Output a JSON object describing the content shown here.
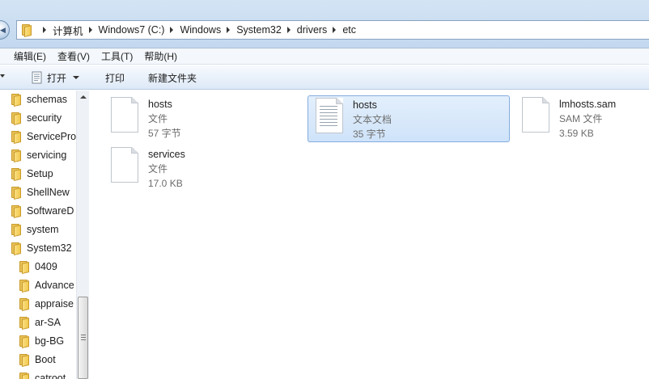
{
  "address": {
    "crumbs": [
      "计算机",
      "Windows7 (C:)",
      "Windows",
      "System32",
      "drivers",
      "etc"
    ]
  },
  "menu": [
    "编辑(E)",
    "查看(V)",
    "工具(T)",
    "帮助(H)"
  ],
  "toolbar": {
    "open_label": "打开",
    "print_label": "打印",
    "new_folder_label": "新建文件夹"
  },
  "sidebar": {
    "items": [
      {
        "label": "schemas"
      },
      {
        "label": "security"
      },
      {
        "label": "ServicePro"
      },
      {
        "label": "servicing"
      },
      {
        "label": "Setup"
      },
      {
        "label": "ShellNew"
      },
      {
        "label": "SoftwareD"
      },
      {
        "label": "system"
      },
      {
        "label": "System32"
      },
      {
        "label": "0409"
      },
      {
        "label": "Advance"
      },
      {
        "label": "appraise"
      },
      {
        "label": "ar-SA"
      },
      {
        "label": "bg-BG"
      },
      {
        "label": "Boot"
      },
      {
        "label": "catroot"
      }
    ]
  },
  "files": [
    {
      "name": "hosts",
      "type": "文件",
      "size": "57 字节",
      "icon": "blank-file-icon"
    },
    {
      "name": "hosts",
      "type": "文本文档",
      "size": "35 字节",
      "icon": "text-document-icon"
    },
    {
      "name": "lmhosts.sam",
      "type": "SAM 文件",
      "size": "3.59 KB",
      "icon": "blank-file-icon"
    },
    {
      "name": "services",
      "type": "文件",
      "size": "17.0 KB",
      "icon": "blank-file-icon"
    }
  ]
}
